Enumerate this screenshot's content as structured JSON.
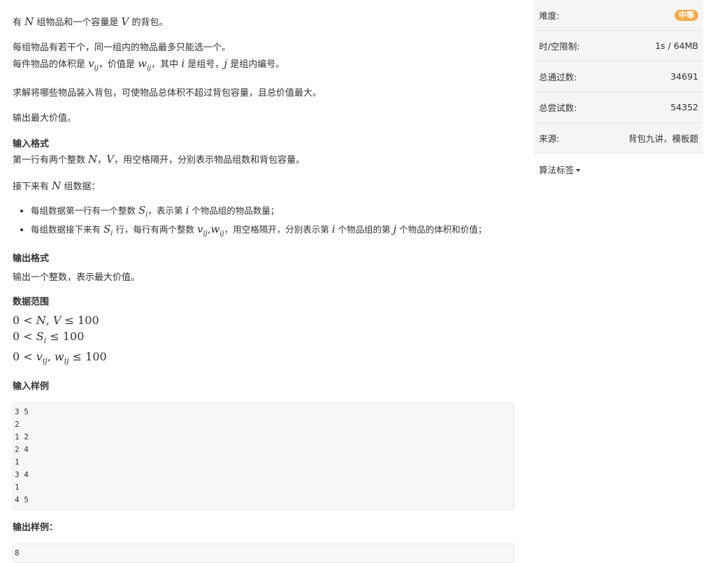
{
  "problem": {
    "intro_pre": "有",
    "intro_N": "N",
    "intro_mid": " 组物品和一个容量是 ",
    "intro_V": "V",
    "intro_post": " 的背包。",
    "line2": "每组物品有若干个，同一组内的物品最多只能选一个。",
    "line3_a": "每件物品的体积是",
    "line3_v": "v",
    "line3_vsub": "ij",
    "line3_b": "，价值是",
    "line3_w": "w",
    "line3_wsub": "ij",
    "line3_c": "，其中",
    "line3_i": "i",
    "line3_d": "是组号，",
    "line3_j": "j",
    "line3_e": "是组内编号。",
    "line4": "求解将哪些物品装入背包，可使物品总体积不超过背包容量，且总价值最大。",
    "line5": "输出最大价值。",
    "input_heading": "输入格式",
    "input_l1_a": "第一行有两个整数",
    "input_l1_N": "N",
    "input_l1_comma": "，",
    "input_l1_V": "V",
    "input_l1_b": "，用空格隔开，分别表示物品组数和背包容量。",
    "input_l2_a": "接下来有",
    "input_l2_N": "N",
    "input_l2_b": "组数据：",
    "bullet1_a": "每组数据第一行有一个整数",
    "bullet1_S": "S",
    "bullet1_Ssub": "i",
    "bullet1_b": "，表示第",
    "bullet1_i": "i",
    "bullet1_c": "个物品组的物品数量；",
    "bullet2_a": "每组数据接下来有",
    "bullet2_S": "S",
    "bullet2_Ssub": "i",
    "bullet2_b": "行，每行有两个整数",
    "bullet2_v": "v",
    "bullet2_vsub": "ij",
    "bullet2_comma": ",",
    "bullet2_w": "w",
    "bullet2_wsub": "ij",
    "bullet2_c": "，用空格隔开，分别表示第",
    "bullet2_i": "i",
    "bullet2_d": "个物品组的第",
    "bullet2_j": "j",
    "bullet2_e": "个物品的体积和价值；",
    "output_heading": "输出格式",
    "output_text": "输出一个整数，表示最大价值。",
    "range_heading": "数据范围",
    "range1_a": "0 < ",
    "range1_v": "N",
    "range1_comma": ", ",
    "range1_v2": "V",
    "range1_b": " ≤ 100",
    "range2_a": "0 < ",
    "range2_v": "S",
    "range2_sub": "i",
    "range2_b": " ≤ 100",
    "range3_a": "0 < ",
    "range3_v": "v",
    "range3_vsub": "ij",
    "range3_comma": ", ",
    "range3_w": "w",
    "range3_wsub": "ij",
    "range3_b": " ≤ 100",
    "sample_in_heading": "输入样例",
    "sample_in": "3 5\n2\n1 2\n2 4\n1\n3 4\n1\n4 5",
    "sample_out_heading": "输出样例：",
    "sample_out": "8"
  },
  "sidebar": {
    "difficulty_label": "难度:",
    "difficulty_value": "中等",
    "difficulty_color": "#f0ad4e",
    "limit_label": "时/空限制:",
    "limit_value": "1s / 64MB",
    "passed_label": "总通过数:",
    "passed_value": "34691",
    "attempts_label": "总尝试数:",
    "attempts_value": "54352",
    "source_label": "来源:",
    "source_value": "背包九讲，模板题",
    "tags_label": "算法标签"
  }
}
